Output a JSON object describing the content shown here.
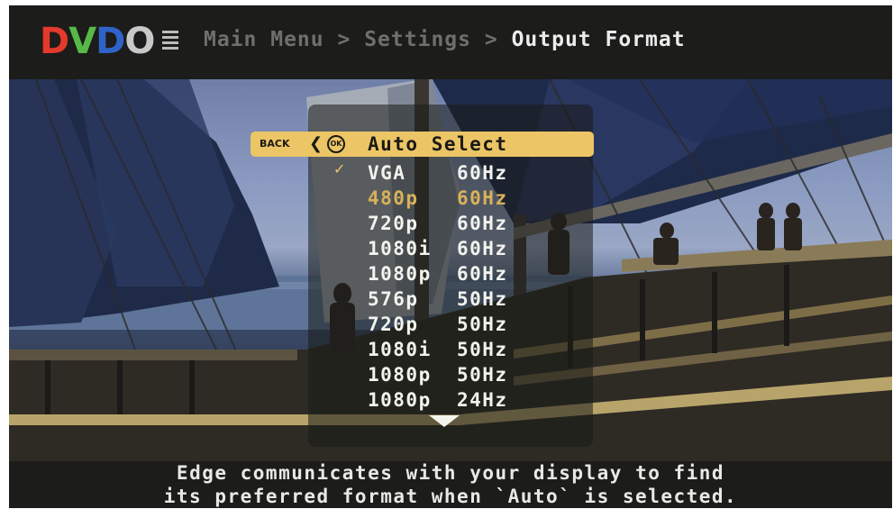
{
  "header": {
    "logo_text": "DVDO",
    "breadcrumb": [
      "Main Menu",
      "Settings",
      "Output Format"
    ],
    "separator": ">"
  },
  "menu": {
    "back_label": "BACK",
    "ok_label": "OK",
    "selected_item": "Auto Select",
    "items": [
      {
        "label": "VGA    60Hz",
        "checked": true
      },
      {
        "label": "480p   60Hz",
        "muted": true
      },
      {
        "label": "720p   60Hz"
      },
      {
        "label": "1080i  60Hz"
      },
      {
        "label": "1080p  60Hz"
      },
      {
        "label": "576p   50Hz"
      },
      {
        "label": "720p   50Hz"
      },
      {
        "label": "1080i  50Hz"
      },
      {
        "label": "1080p  50Hz"
      },
      {
        "label": "1080p  24Hz"
      }
    ]
  },
  "footer": {
    "line1": "Edge communicates with your display to find",
    "line2": "its preferred format when `Auto` is selected."
  },
  "colors": {
    "highlight": "#ecc566",
    "muted_item": "#d8b25a",
    "text": "#f3f3ee"
  }
}
